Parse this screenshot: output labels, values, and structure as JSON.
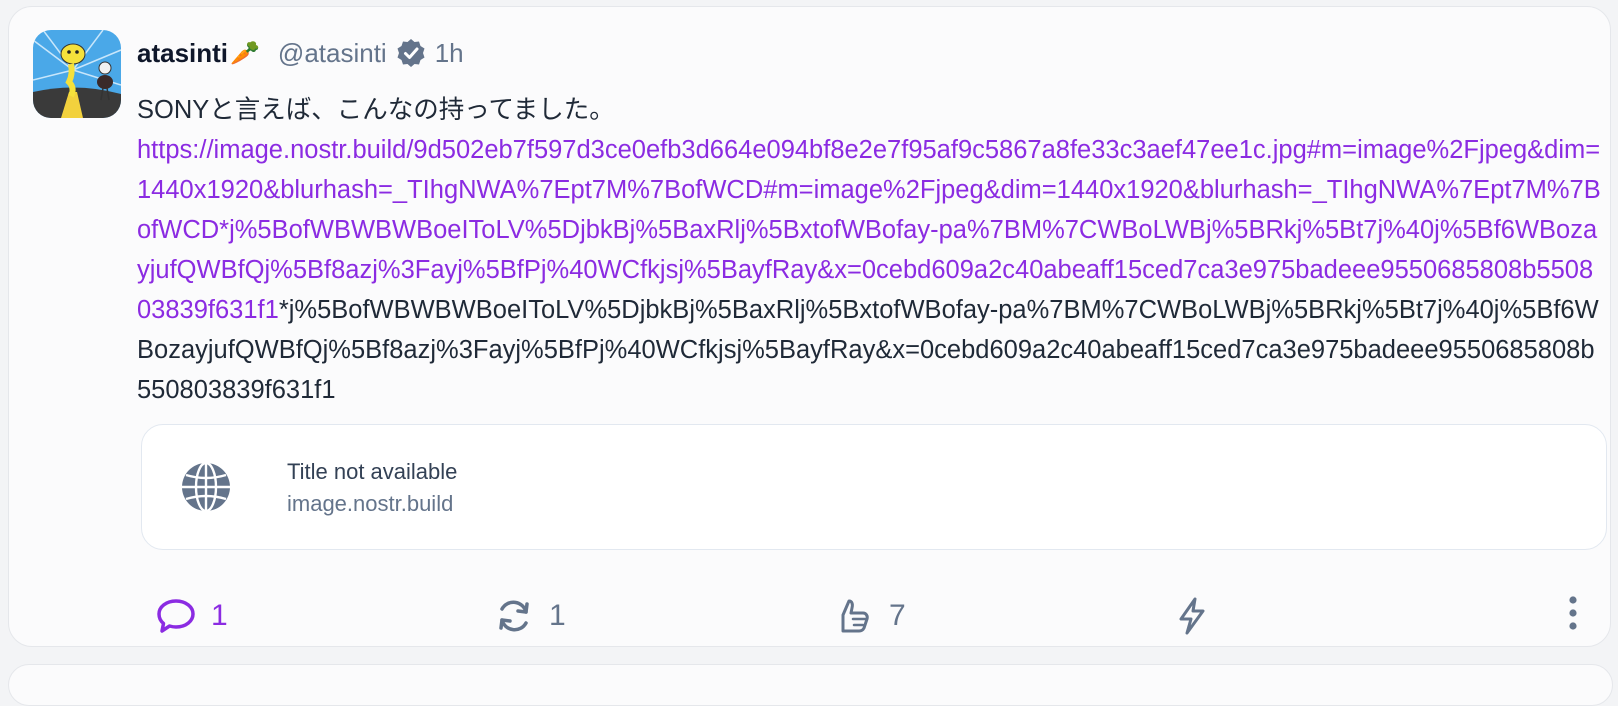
{
  "post": {
    "author": {
      "display_name": "atasinti",
      "emoji": "🥕",
      "handle": "@atasinti",
      "verified_icon": "verified-badge-icon",
      "avatar_icon": "avatar-image"
    },
    "time": "1h",
    "text": "SONYと言えば、こんなの持ってました。",
    "link": "https://image.nostr.build/9d502eb7f597d3ce0efb3d664e094bf8e2e7f95af9c5867a8fe33c3aef47ee1c.jpg#m=image%2Fjpeg&dim=1440x1920&blurhash=_TIhgNWA%7Ept7M%7BofWCD#m=image%2Fjpeg&dim=1440x1920&blurhash=_TIhgNWA%7Ept7M%7BofWCD*j%5BofWBWBWBoeIToLV%5DjbkBj%5BaxRlj%5BxtofWBofay-pa%7BM%7CWBoLWBj%5BRkj%5Bt7j%40j%5Bf6WBozayjufQWBfQj%5Bf8azj%3Fayj%5BfPj%40WCfkjsj%5BayfRay&x=0cebd609a2c40abeaff15ced7ca3e975badeee9550685808b550803839f631f1",
    "trailing_text": "*j%5BofWBWBWBoeIToLV%5DjbkBj%5BaxRlj%5BxtofWBofay-pa%7BM%7CWBoLWBj%5BRkj%5Bt7j%40j%5Bf6WBozayjufQWBfQj%5Bf8azj%3Fayj%5BfPj%40WCfkjsj%5BayfRay&x=0cebd609a2c40abeaff15ced7ca3e975badeee9550685808b550803839f631f1",
    "preview": {
      "icon": "globe-icon",
      "title": "Title not available",
      "domain": "image.nostr.build"
    },
    "actions": {
      "replies": "1",
      "reposts": "1",
      "likes": "7",
      "zap_icon": "zap-icon",
      "more_icon": "more-vertical-icon"
    }
  },
  "colors": {
    "accent": "#8b2be2",
    "muted": "#64748b",
    "text": "#1f2937"
  }
}
